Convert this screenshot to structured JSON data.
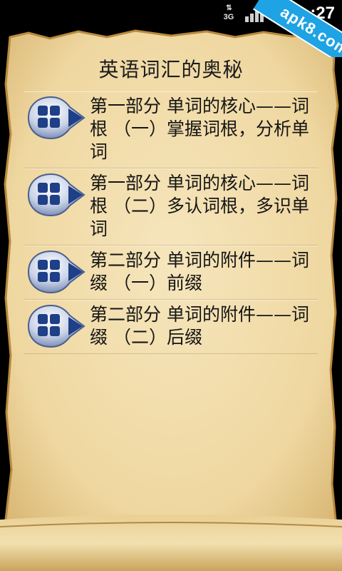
{
  "status_bar": {
    "network": "3G",
    "time": ":27"
  },
  "watermark": {
    "text": "apk8.com"
  },
  "page": {
    "title": "英语词汇的奥秘"
  },
  "menu": {
    "items": [
      {
        "label": "第一部分 单词的核心——词根 （一）掌握词根，分析单词"
      },
      {
        "label": "第一部分 单词的核心——词根 （二）多认词根，多识单词"
      },
      {
        "label": "第二部分 单词的附件——词缀 （一）前缀"
      },
      {
        "label": "第二部分 单词的附件——词缀 （二）后缀"
      }
    ]
  },
  "colors": {
    "parchment": "#f1dba6",
    "parchment_edge": "#c9a45c",
    "icon_blue": "#1f3f86",
    "watermark": "#1ea3e4"
  }
}
